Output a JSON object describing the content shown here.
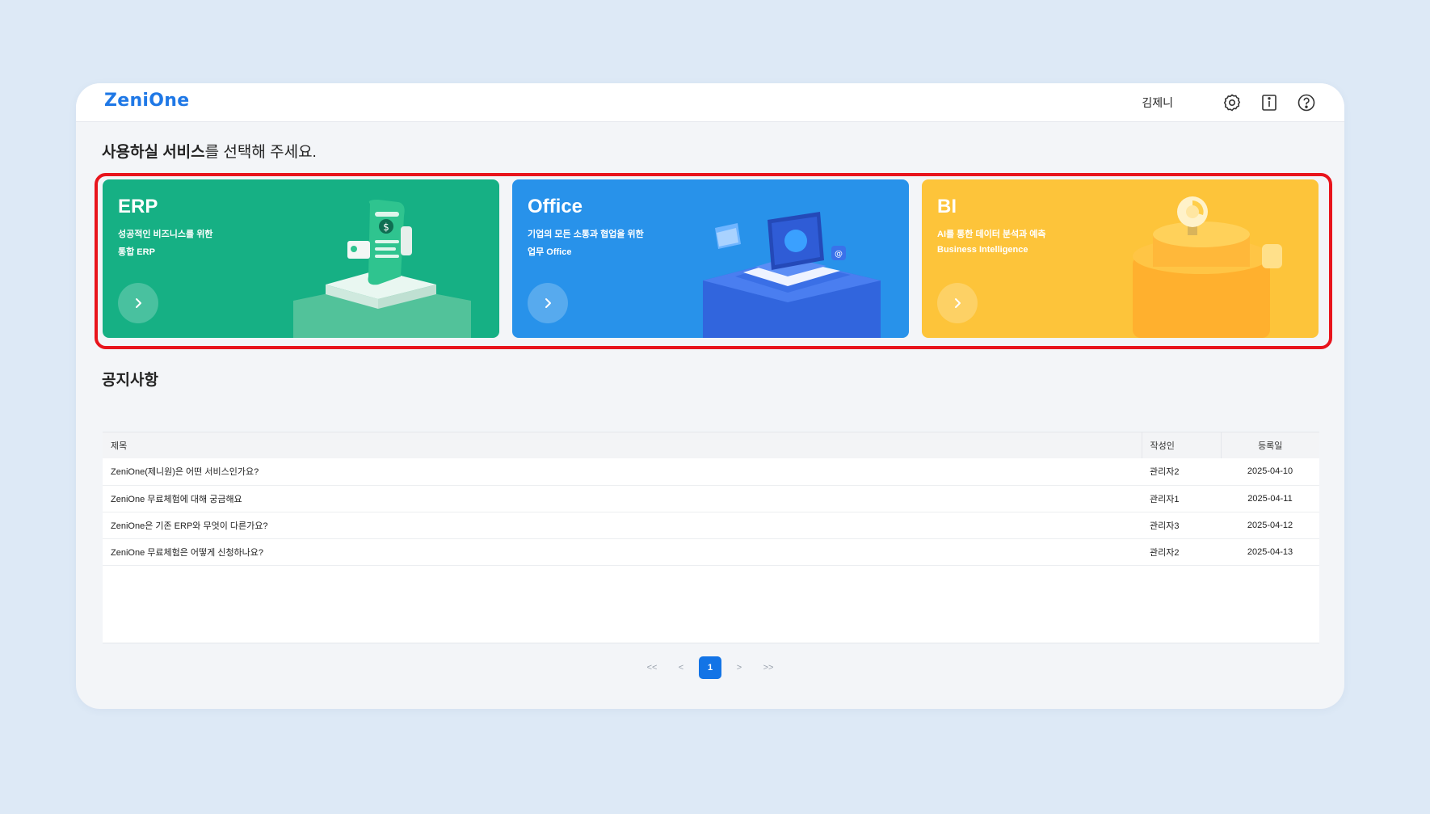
{
  "header": {
    "logo": "ZeniOne",
    "user_name": "김제니",
    "icons": [
      "settings-icon",
      "info-icon",
      "help-icon"
    ]
  },
  "services": {
    "title_bold": "사용하실 서비스",
    "title_rest": "를 선택해 주세요.",
    "cards": [
      {
        "title": "ERP",
        "line1": "성공적인 비즈니스를 위한",
        "line2": "통합 ERP",
        "color": "#16b084"
      },
      {
        "title": "Office",
        "line1": "기업의 모든 소통과 협업을 위한",
        "line2": "업무 Office",
        "color": "#2892ea"
      },
      {
        "title": "BI",
        "line1": "AI를 통한 데이터 분석과 예측",
        "line2": "Business Intelligence",
        "color": "#fdc43a"
      }
    ]
  },
  "notice": {
    "title": "공지사항",
    "columns": {
      "title": "제목",
      "author": "작성인",
      "date": "등록일"
    },
    "rows": [
      {
        "title": "ZeniOne(제니원)은 어떤 서비스인가요?",
        "author": "관리자2",
        "date": "2025-04-10"
      },
      {
        "title": "ZeniOne 무료체험에 대해 궁금해요",
        "author": "관리자1",
        "date": "2025-04-11"
      },
      {
        "title": "ZeniOne은 기존 ERP와 무엇이 다른가요?",
        "author": "관리자3",
        "date": "2025-04-12"
      },
      {
        "title": "ZeniOne 무료체험은 어떻게 신청하나요?",
        "author": "관리자2",
        "date": "2025-04-13"
      }
    ]
  },
  "pagination": {
    "first": "<<",
    "prev": "<",
    "current": "1",
    "next": ">",
    "last": ">>"
  },
  "colors": {
    "accent": "#1374e6",
    "highlight_border": "#e8141c"
  }
}
